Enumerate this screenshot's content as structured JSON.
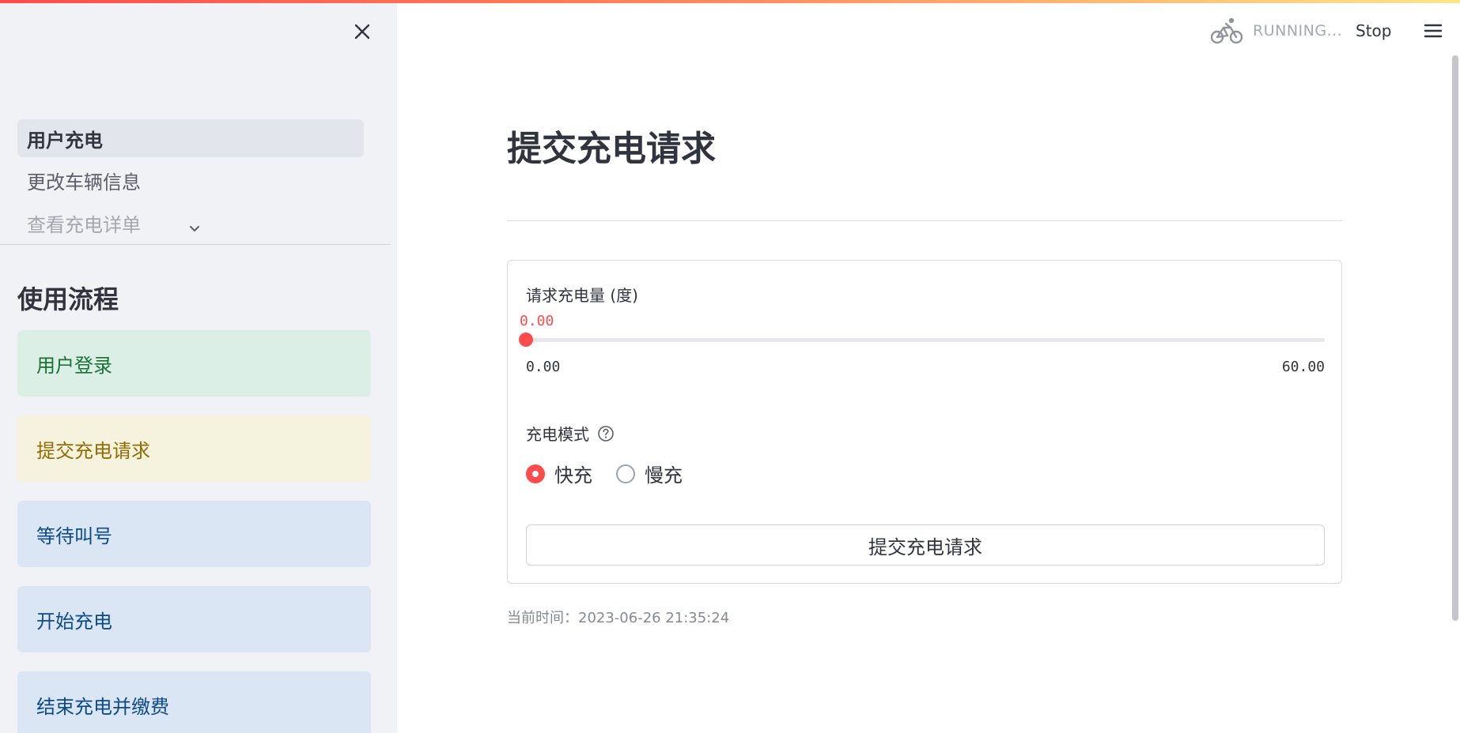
{
  "sidebar": {
    "nav_items": [
      {
        "label": "用户充电"
      },
      {
        "label": "更改车辆信息"
      },
      {
        "label": "查看充电详单"
      }
    ],
    "flow_title": "使用流程",
    "flow_steps": [
      {
        "label": "用户登录",
        "tone": "green"
      },
      {
        "label": "提交充电请求",
        "tone": "yellow"
      },
      {
        "label": "等待叫号",
        "tone": "blue"
      },
      {
        "label": "开始充电",
        "tone": "blue"
      },
      {
        "label": "结束充电并缴费",
        "tone": "blue"
      }
    ]
  },
  "header": {
    "status": "RUNNING...",
    "stop_label": "Stop"
  },
  "main": {
    "title": "提交充电请求",
    "slider": {
      "label": "请求充电量 (度)",
      "value": 0.0,
      "value_text": "0.00",
      "min": 0.0,
      "max": 60.0,
      "min_text": "0.00",
      "max_text": "60.00"
    },
    "radio": {
      "label": "充电模式",
      "options": [
        {
          "label": "快充",
          "checked": true
        },
        {
          "label": "慢充",
          "checked": false
        }
      ]
    },
    "submit_label": "提交充电请求",
    "time_text": "当前时间：2023-06-26 21:35:24"
  },
  "colors": {
    "accent": "#ff4b4b",
    "sidebar_bg": "#f0f2f6",
    "green_card_bg": "#dcefe6",
    "yellow_card_bg": "#f5f2de",
    "blue_card_bg": "#dbe6f4"
  },
  "icons": {
    "close": "close-icon",
    "chevron": "chevron-down-icon",
    "status": "bicycle-icon",
    "menu": "hamburger-menu-icon",
    "help": "question-circle-icon"
  }
}
